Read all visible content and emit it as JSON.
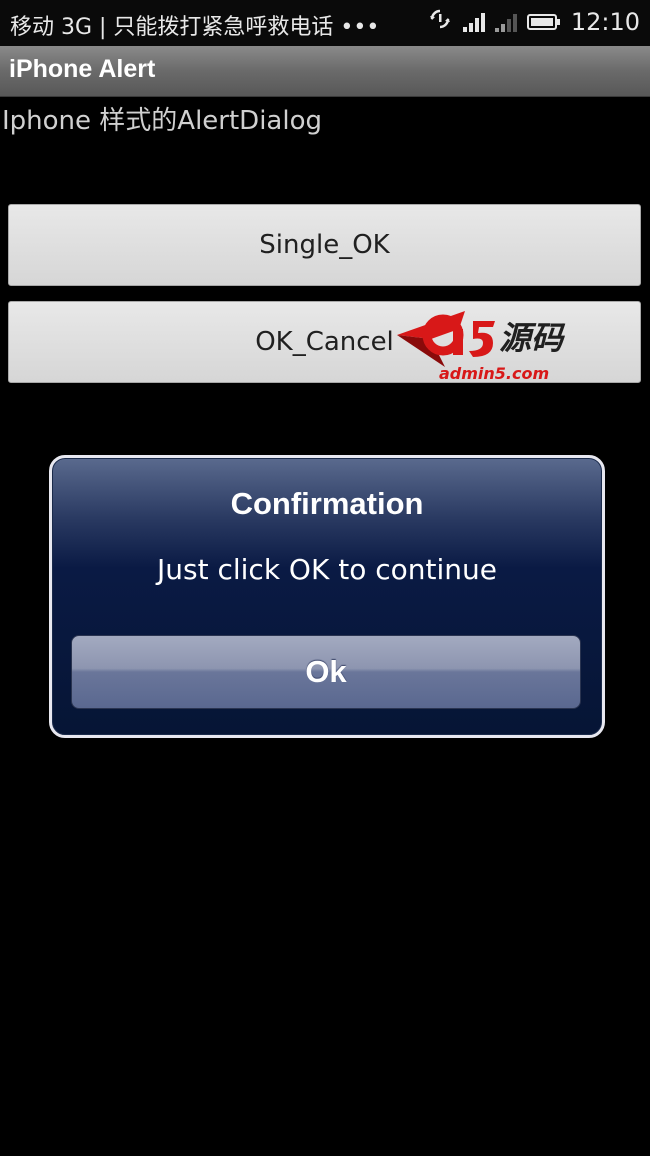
{
  "status_bar": {
    "carrier": "移动 3G | 只能拨打紧急呼救电话 •••",
    "time": "12:10",
    "icons": [
      "sync-icon",
      "signal-icon",
      "signal-weak-icon",
      "battery-icon"
    ]
  },
  "title_bar": {
    "title": "iPhone Alert"
  },
  "main": {
    "subtitle": "Iphone 样式的AlertDialog",
    "buttons": [
      {
        "label": "Single_OK"
      },
      {
        "label": "OK_Cancel"
      }
    ]
  },
  "watermark": {
    "brand": "a5源码",
    "domain": "admin5.com"
  },
  "dialog": {
    "title": "Confirmation",
    "message": "Just click OK to continue",
    "ok_label": "Ok"
  },
  "colors": {
    "background": "#000000",
    "dialog_bg": "#061535",
    "dialog_border": "#e8e8f0",
    "button_bg": "#e0e0e0",
    "watermark_red": "#d81818"
  }
}
